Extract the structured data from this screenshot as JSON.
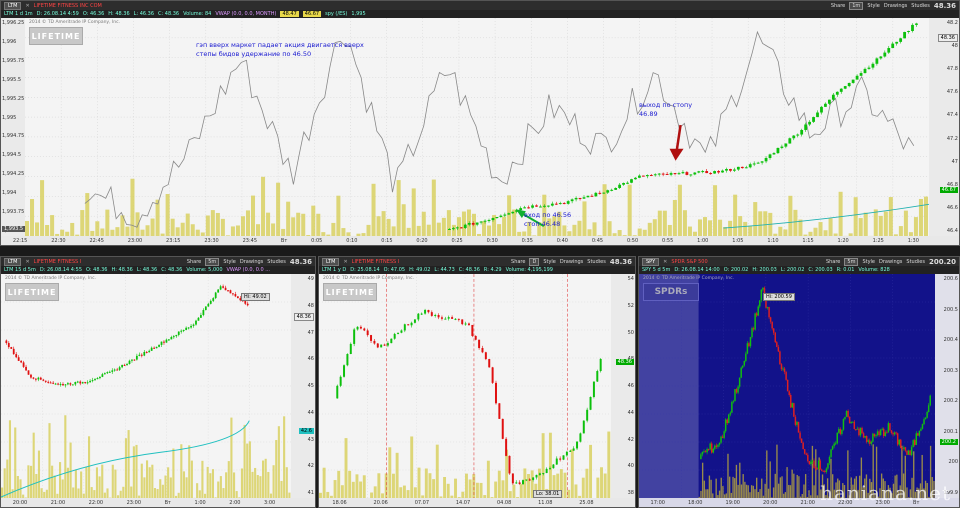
{
  "common": {
    "share": "Share",
    "style": "Style",
    "drawings": "Drawings",
    "studies": "Studies",
    "copyright": "2014 © TD Ameritrade IP Company, Inc."
  },
  "main": {
    "symbol": "LTM",
    "name": "LIFETIME FITNESS INC COM",
    "timeframe": "1m",
    "price": "48.36",
    "quote": {
      "label": "LTM 1 d 1m",
      "d": "D: 26.08.14 4:59",
      "o": "O: 46.36",
      "h": "H: 48.36",
      "l": "L: 46.36",
      "c": "C: 48.36",
      "v": "Volume: 84",
      "vwap": "VWAP (0.0, 0.0, MONTH)",
      "vwap_val": "48.47",
      "vwap_hl": "46.67",
      "spy": "spy (/ES)",
      "spy_val": "1,995"
    },
    "notes": [
      "гэп вверх маркет падает акция двигается вверх",
      "степы бидов удержание по 46.50"
    ],
    "exit_note": [
      "выход по стопу",
      "46.89"
    ],
    "entry_note": [
      "вход по 46.56",
      "стоп 46.48"
    ],
    "left_axis": [
      "1,996.25",
      "1,996",
      "1,995.75",
      "1,995.5",
      "1,995.25",
      "1,995",
      "1,994.75",
      "1,994.5",
      "1,994.25",
      "1,994",
      "1,993.75",
      "1,993.5"
    ],
    "right_axis": [
      "48.2",
      "48",
      "47.8",
      "47.6",
      "47.4",
      "47.2",
      "47",
      "46.8",
      "46.6",
      "46.4"
    ],
    "last_tag": "48.36",
    "vwap_tag": "46.67",
    "left_tag": "1,993.5",
    "xticks": [
      "22:15",
      "22:30",
      "22:45",
      "23:00",
      "23:15",
      "23:30",
      "23:45",
      "Вт",
      "0:05",
      "0:10",
      "0:15",
      "0:20",
      "0:25",
      "0:30",
      "0:35",
      "0:40",
      "0:45",
      "0:50",
      "0:55",
      "1:00",
      "1:05",
      "1:10",
      "1:15",
      "1:20",
      "1:25",
      "1:30"
    ],
    "colors": {
      "up": "#0cc00c",
      "down": "#e01010",
      "vol": "#d8d060",
      "line": "#888888",
      "arrow_green": "#10b030",
      "arrow_red": "#b01010"
    }
  },
  "p2": {
    "symbol": "LTM",
    "name": "LIFETIME FITNESS I",
    "timeframe": "5m",
    "price": "48.36",
    "quote": {
      "label": "LTM 15 d 5m",
      "d": "D: 26.08.14 4:55",
      "o": "O: 48.36",
      "h": "H: 48.36",
      "l": "L: 48.36",
      "c": "C: 48.36",
      "v": "Volume: 5,000",
      "vwap": "VWAP (0.0, 0.0 ..."
    },
    "hi": "Hi: 49.02",
    "tag": "48.36",
    "tag2": "42.6",
    "right_axis": [
      "49",
      "48",
      "47",
      "46",
      "45",
      "44",
      "43",
      "42",
      "41"
    ],
    "xticks": [
      "20:00",
      "21:00",
      "22:00",
      "23:00",
      "Вт",
      "1:00",
      "2:00",
      "3:00"
    ]
  },
  "p3": {
    "symbol": "LTM",
    "name": "LIFETIME FITNESS I",
    "timeframe": "D",
    "price": "48.36",
    "quote": {
      "label": "LTM 1 y D",
      "d": "D: 25.08.14",
      "o": "O: 47.05",
      "h": "H: 49.02",
      "l": "L: 44.73",
      "c": "C: 48.36",
      "chg": "R: 4.29",
      "v": "Volume: 4,195,199"
    },
    "lo": "Lo: 38.01",
    "tag": "48.36",
    "right_axis": [
      "54",
      "52",
      "50",
      "48",
      "46",
      "44",
      "42",
      "40",
      "38"
    ],
    "xticks": [
      "18.06",
      "20.06",
      "07.07",
      "14.07",
      "04.08",
      "11.08",
      "25.08"
    ],
    "event_dates": [
      "20.06.14",
      "18.07.14",
      "22.08.14"
    ]
  },
  "p4": {
    "symbol": "SPY",
    "name": "SPDR S&P 500",
    "timeframe": "5m",
    "price": "200.20",
    "quote": {
      "label": "SPY 5 d 5m",
      "d": "D: 26.08.14 14:00",
      "o": "O: 200.02",
      "h": "H: 200.03",
      "l": "L: 200.02",
      "c": "C: 200.03",
      "chg": "R: 0.01",
      "v": "Volume: 828"
    },
    "hi": "Hi: 200.59",
    "logo": "SPDRs",
    "tag": "200.2",
    "right_axis": [
      "200.6",
      "200.5",
      "200.4",
      "200.3",
      "200.2",
      "200.1",
      "200",
      "199.9"
    ],
    "xticks": [
      "17:00",
      "18:00",
      "19:00",
      "20:00",
      "21:00",
      "22:00",
      "23:00",
      "Вт"
    ]
  },
  "watermark": "haniana.net",
  "chart_data": [
    {
      "type": "line",
      "title": "LTM 1 d 1m",
      "ylim": [
        46.3,
        48.4
      ],
      "x": [
        "23:45",
        "0:00",
        "0:15",
        "0:30",
        "0:45",
        "1:00",
        "1:15",
        "1:30"
      ],
      "series": [
        {
          "name": "LTM",
          "values": [
            46.45,
            46.56,
            46.7,
            46.89,
            46.9,
            47.0,
            47.5,
            48.36
          ]
        }
      ]
    },
    {
      "type": "line",
      "title": "LTM 15 d 5m",
      "ylim": [
        41,
        49.5
      ],
      "x": [
        "20:00",
        "21:00",
        "22:00",
        "23:00",
        "Вт",
        "1:00",
        "2:00"
      ],
      "series": [
        {
          "name": "LTM",
          "values": [
            47.0,
            45.2,
            45.3,
            45.6,
            46.2,
            47.0,
            49.02
          ]
        }
      ]
    },
    {
      "type": "line",
      "title": "LTM 1 y D",
      "ylim": [
        37,
        55
      ],
      "x": [
        "18.06",
        "20.06",
        "07.07",
        "14.07",
        "04.08",
        "11.08",
        "25.08"
      ],
      "series": [
        {
          "name": "LTM",
          "values": [
            51,
            48,
            50,
            49,
            38.01,
            40,
            48.36
          ]
        }
      ]
    },
    {
      "type": "line",
      "title": "SPY 5 d 5m",
      "ylim": [
        199.85,
        200.65
      ],
      "x": [
        "17:00",
        "18:00",
        "19:00",
        "20:00",
        "21:00",
        "22:00",
        "23:00",
        "Вт"
      ],
      "series": [
        {
          "name": "SPY",
          "values": [
            200.0,
            200.2,
            200.59,
            200.1,
            199.95,
            200.15,
            200.0,
            200.2
          ]
        }
      ]
    }
  ]
}
